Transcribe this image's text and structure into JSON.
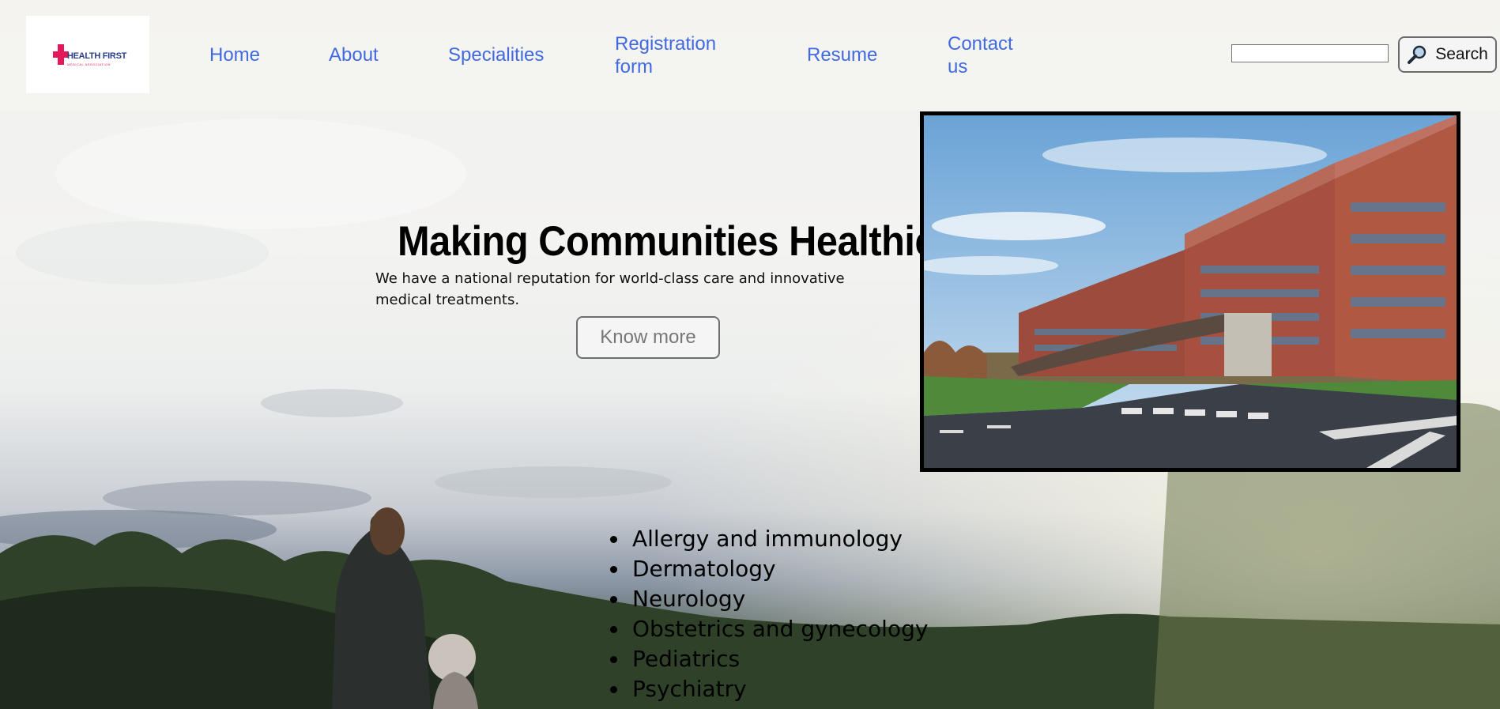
{
  "header": {
    "logo": {
      "name": "HEALTH FIRST",
      "tagline": "MEDICAL ASSOCIATION"
    },
    "nav": [
      {
        "label": "Home"
      },
      {
        "label": "About"
      },
      {
        "label": "Specialities"
      },
      {
        "label": "Registration form"
      },
      {
        "label": "Resume"
      },
      {
        "label": "Contact us"
      }
    ],
    "search": {
      "value": "",
      "button_label": "Search",
      "icon": "magnifier-icon"
    }
  },
  "hero": {
    "title": "Making Communities Healthier",
    "description": "We have a national reputation for world-class care and innovative medical treatments.",
    "button_label": "Know more"
  },
  "specialities": [
    "Allergy and immunology",
    "Dermatology",
    "Neurology",
    "Obstetrics and gynecology",
    "Pediatrics",
    "Psychiatry"
  ],
  "colors": {
    "nav_link": "#4169e1",
    "logo_accent": "#e2185b",
    "logo_text": "#2a3e88"
  }
}
